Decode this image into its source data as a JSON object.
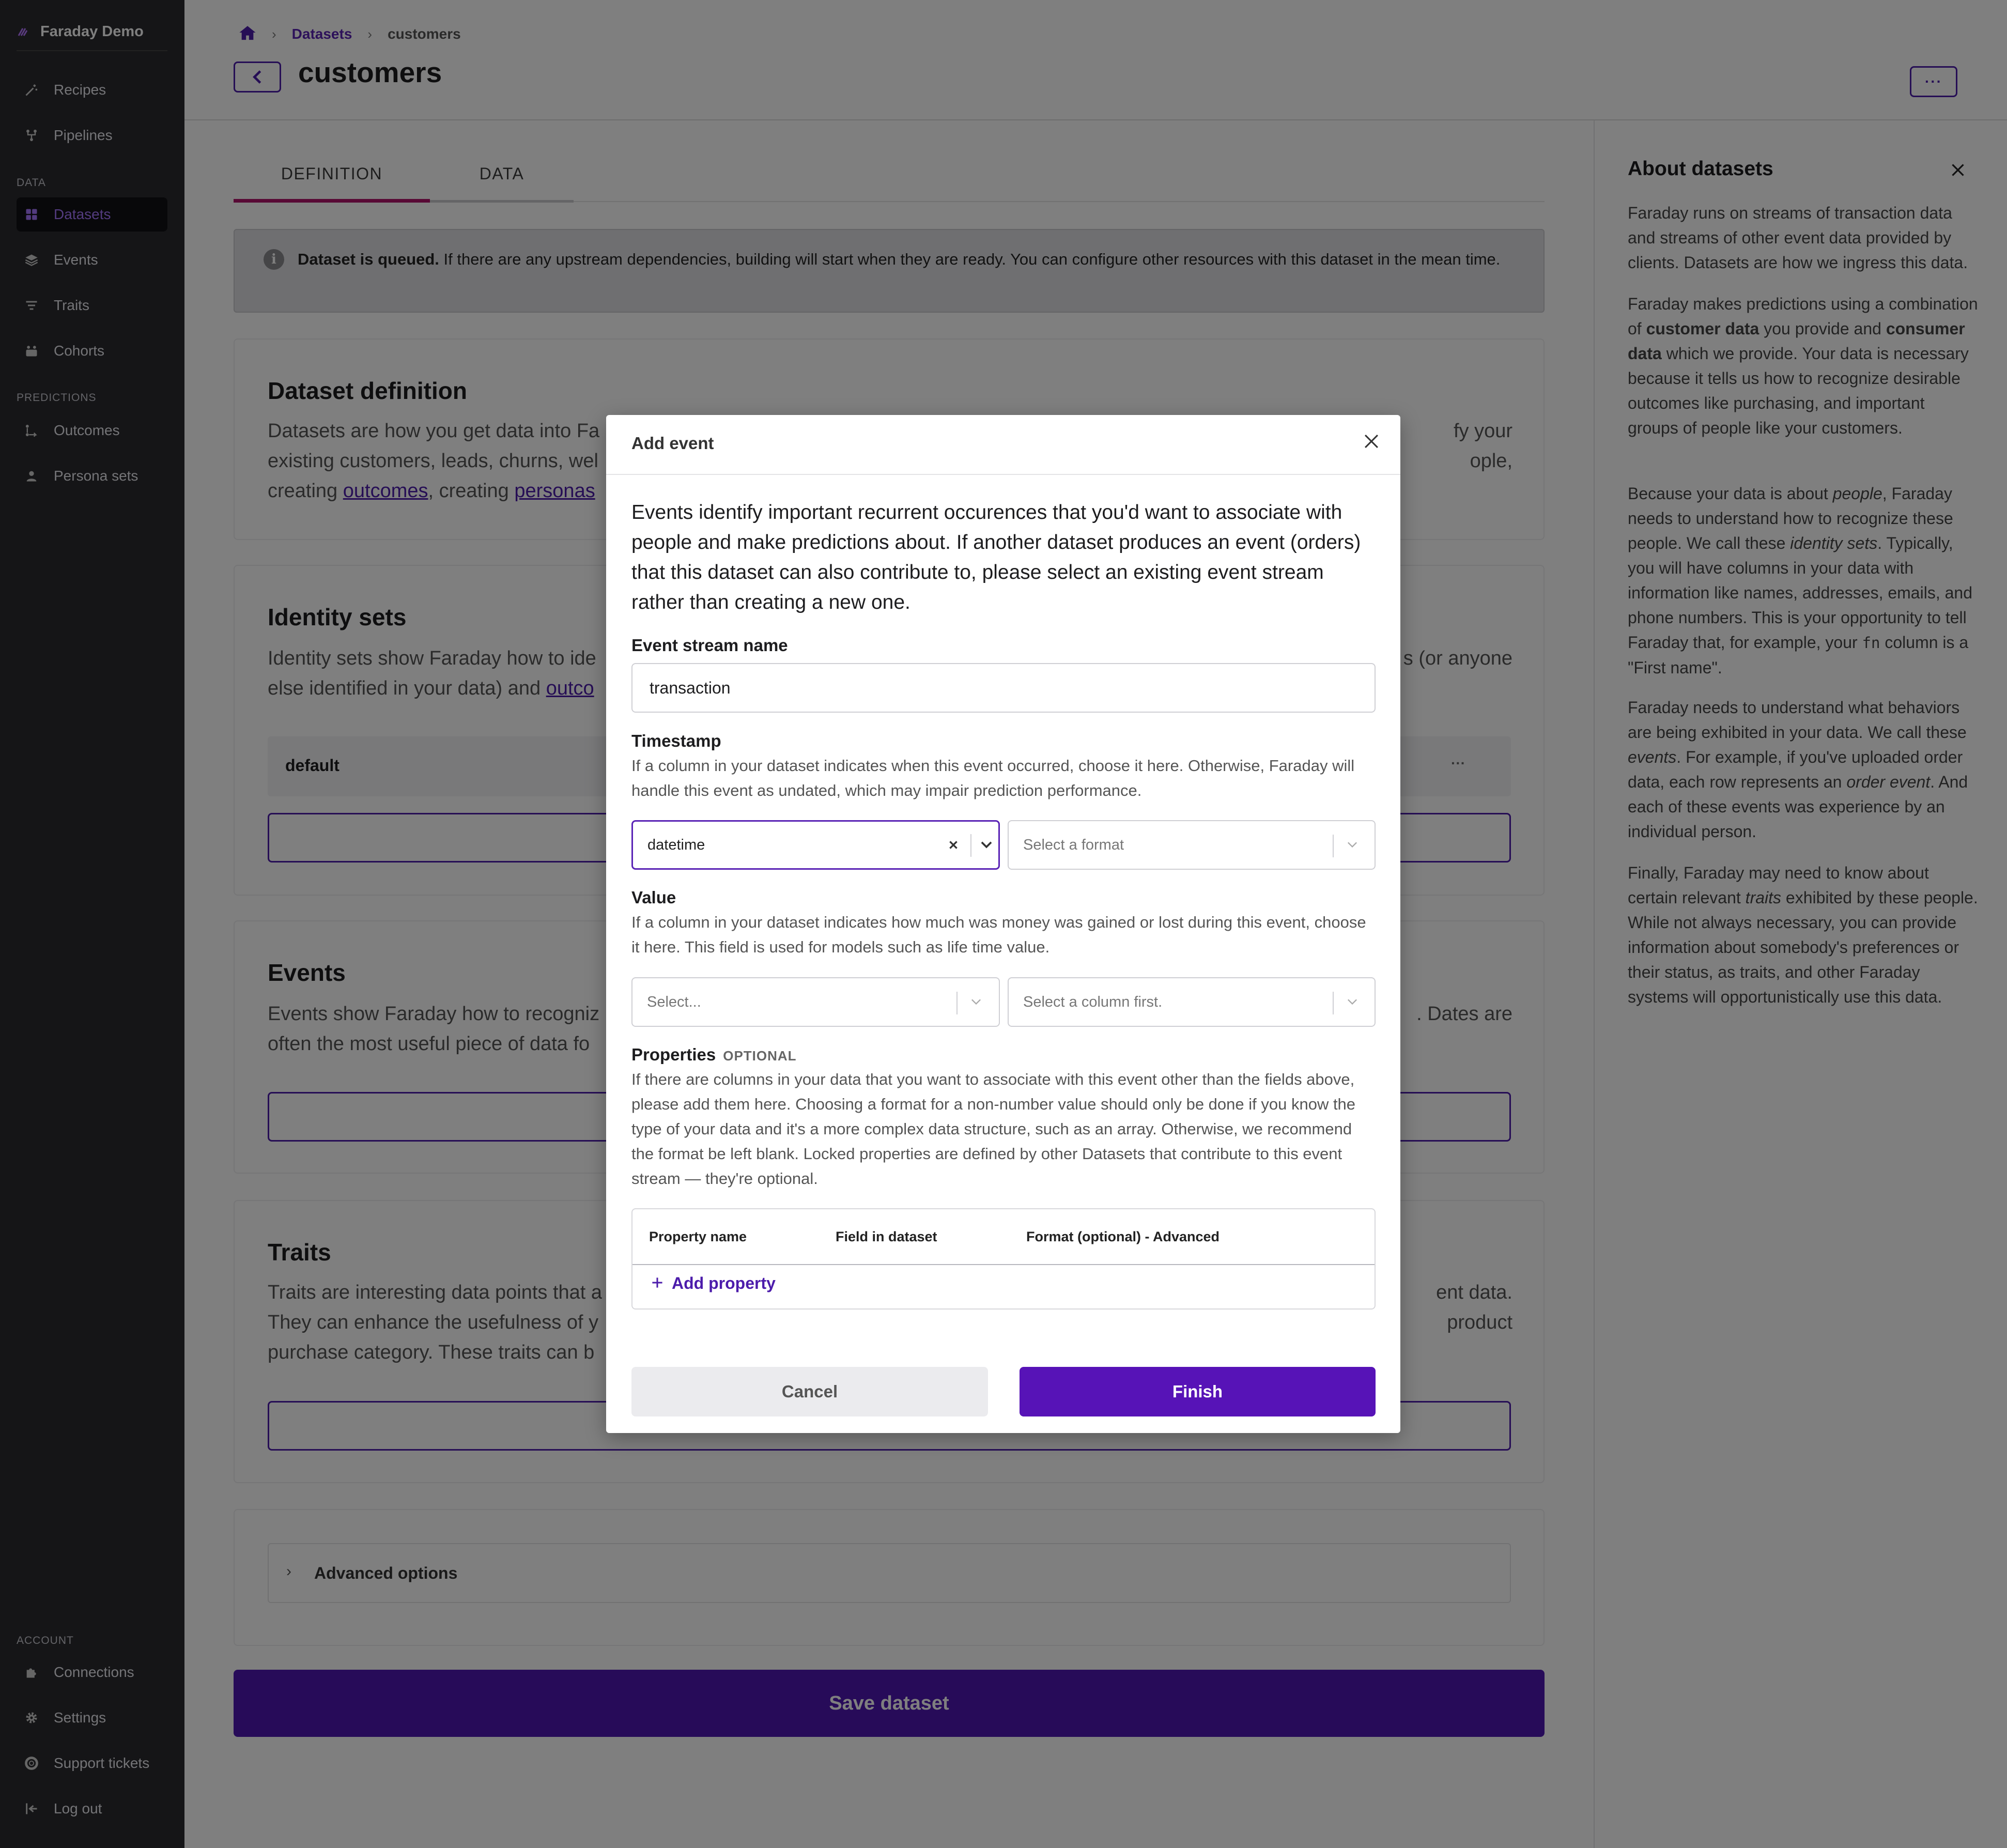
{
  "sidebar": {
    "brand": "Faraday Demo",
    "nav_top": [
      {
        "label": "Recipes",
        "icon": "magic-wand-icon"
      },
      {
        "label": "Pipelines",
        "icon": "pipeline-icon"
      }
    ],
    "data_section": "DATA",
    "data_items": [
      {
        "label": "Datasets",
        "icon": "grid-icon",
        "active": true
      },
      {
        "label": "Events",
        "icon": "layers-icon"
      },
      {
        "label": "Traits",
        "icon": "filter-icon"
      },
      {
        "label": "Cohorts",
        "icon": "people-icon"
      }
    ],
    "predictions_section": "PREDICTIONS",
    "prediction_items": [
      {
        "label": "Outcomes",
        "icon": "outcomes-icon"
      },
      {
        "label": "Persona sets",
        "icon": "persona-icon"
      }
    ],
    "account_section": "ACCOUNT",
    "account_items": [
      {
        "label": "Connections",
        "icon": "puzzle-icon"
      },
      {
        "label": "Settings",
        "icon": "gear-icon"
      },
      {
        "label": "Support tickets",
        "icon": "lifebuoy-icon"
      },
      {
        "label": "Log out",
        "icon": "logout-icon"
      }
    ]
  },
  "breadcrumb": {
    "home_icon": "home-icon",
    "datasets": "Datasets",
    "current": "customers"
  },
  "page_title": "customers",
  "more_label": "···",
  "tabs": [
    {
      "label": "DEFINITION",
      "active": true
    },
    {
      "label": "DATA",
      "active": false
    }
  ],
  "alert": {
    "bold": "Dataset is queued.",
    "text": " If there are any upstream dependencies, building will start when they are ready. You can configure other resources with this dataset in the mean time."
  },
  "cards": {
    "definition": {
      "title": "Dataset definition",
      "desc_part1": "Datasets are how you get data into Fa",
      "desc_part1b": "fy your",
      "desc_line2": "existing customers, leads, churns, wel",
      "desc_line2b": "ople,",
      "desc_line3_pre": "creating ",
      "link1": "outcomes",
      "desc_line3_mid": ", creating ",
      "link2": "personas"
    },
    "identity": {
      "title": "Identity sets",
      "line1a": "Identity sets show Faraday how to ide",
      "line1b": "s (or anyone",
      "line2a": "else identified in your data) and ",
      "link": "outco",
      "row_label": "default",
      "row_more": "···"
    },
    "events": {
      "title": "Events",
      "line1a": "Events show Faraday how to recogniz",
      "line1b": ". Dates are",
      "line2a": "often the most useful piece of data fo"
    },
    "traits": {
      "title": "Traits",
      "line1a": "Traits are interesting data points that a",
      "line1b": "ent data.",
      "line2a": "They can enhance the usefulness of y",
      "line2b": "product",
      "line3a": "purchase category. These traits can b"
    },
    "advanced": {
      "label": "Advanced options"
    }
  },
  "save_label": "Save dataset",
  "about": {
    "title": "About datasets",
    "p1": "Faraday runs on streams of transaction data and streams of other event data provided by clients. Datasets are how we ingress this data.",
    "p2_a": "Faraday makes predictions using a combination of ",
    "p2_b": "customer data",
    "p2_c": " you provide and ",
    "p2_d": "consumer data",
    "p2_e": " which we provide. Your data is necessary because it tells us how to recognize desirable outcomes like purchasing, and important groups of people like your customers.",
    "p3_a": "Because your data is about ",
    "p3_b": "people",
    "p3_c": ", Faraday needs to understand how to recognize these people. We call these ",
    "p3_d": "identity sets",
    "p3_e": ". Typically, you will have columns in your data with information like names, addresses, emails, and phone numbers. This is your opportunity to tell Faraday that, for example, your ",
    "p3_f": "fn",
    "p3_g": " column is a \"First name\".",
    "p4_a": "Faraday needs to understand what behaviors are being exhibited in your data. We call these ",
    "p4_b": "events",
    "p4_c": ". For example, if you've uploaded order data, each row represents an ",
    "p4_d": "order event",
    "p4_e": ". And each of these events was experience by an individual person.",
    "p5_a": "Finally, Faraday may need to know about certain relevant ",
    "p5_b": "traits",
    "p5_c": " exhibited by these people. While not always necessary, you can provide information about somebody's preferences or their status, as traits, and other Faraday systems will opportunistically use this data."
  },
  "modal": {
    "title": "Add event",
    "intro": "Events identify important recurrent occurences that you'd want to associate with people and make predictions about. If another dataset produces an event (orders) that this dataset can also contribute to, please select an existing event stream rather than creating a new one.",
    "stream_label": "Event stream name",
    "stream_value": "transaction",
    "timestamp_label": "Timestamp",
    "timestamp_help": "If a column in your dataset indicates when this event occurred, choose it here. Otherwise, Faraday will handle this event as undated, which may impair prediction performance.",
    "timestamp_column": "datetime",
    "timestamp_format_placeholder": "Select a format",
    "value_label": "Value",
    "value_help": "If a column in your dataset indicates how much was money was gained or lost during this event, choose it here. This field is used for models such as life time value.",
    "value_column_placeholder": "Select...",
    "value_format_placeholder": "Select a column first.",
    "properties_label": "Properties",
    "properties_optional": "OPTIONAL",
    "properties_help": "If there are columns in your data that you want to associate with this event other than the fields above, please add them here. Choosing a format for a non-number value should only be done if you know the type of your data and it's a more complex data structure, such as an array. Otherwise, we recommend the format be left blank. Locked properties are defined by other Datasets that contribute to this event stream — they're optional.",
    "table_headers": [
      "Property name",
      "Field in dataset",
      "Format (optional) - Advanced"
    ],
    "add_property": "Add property",
    "cancel": "Cancel",
    "finish": "Finish"
  },
  "colors": {
    "brand": "#4c1cab",
    "sidebar": "#2a2a2e",
    "finish": "#5713b7"
  }
}
